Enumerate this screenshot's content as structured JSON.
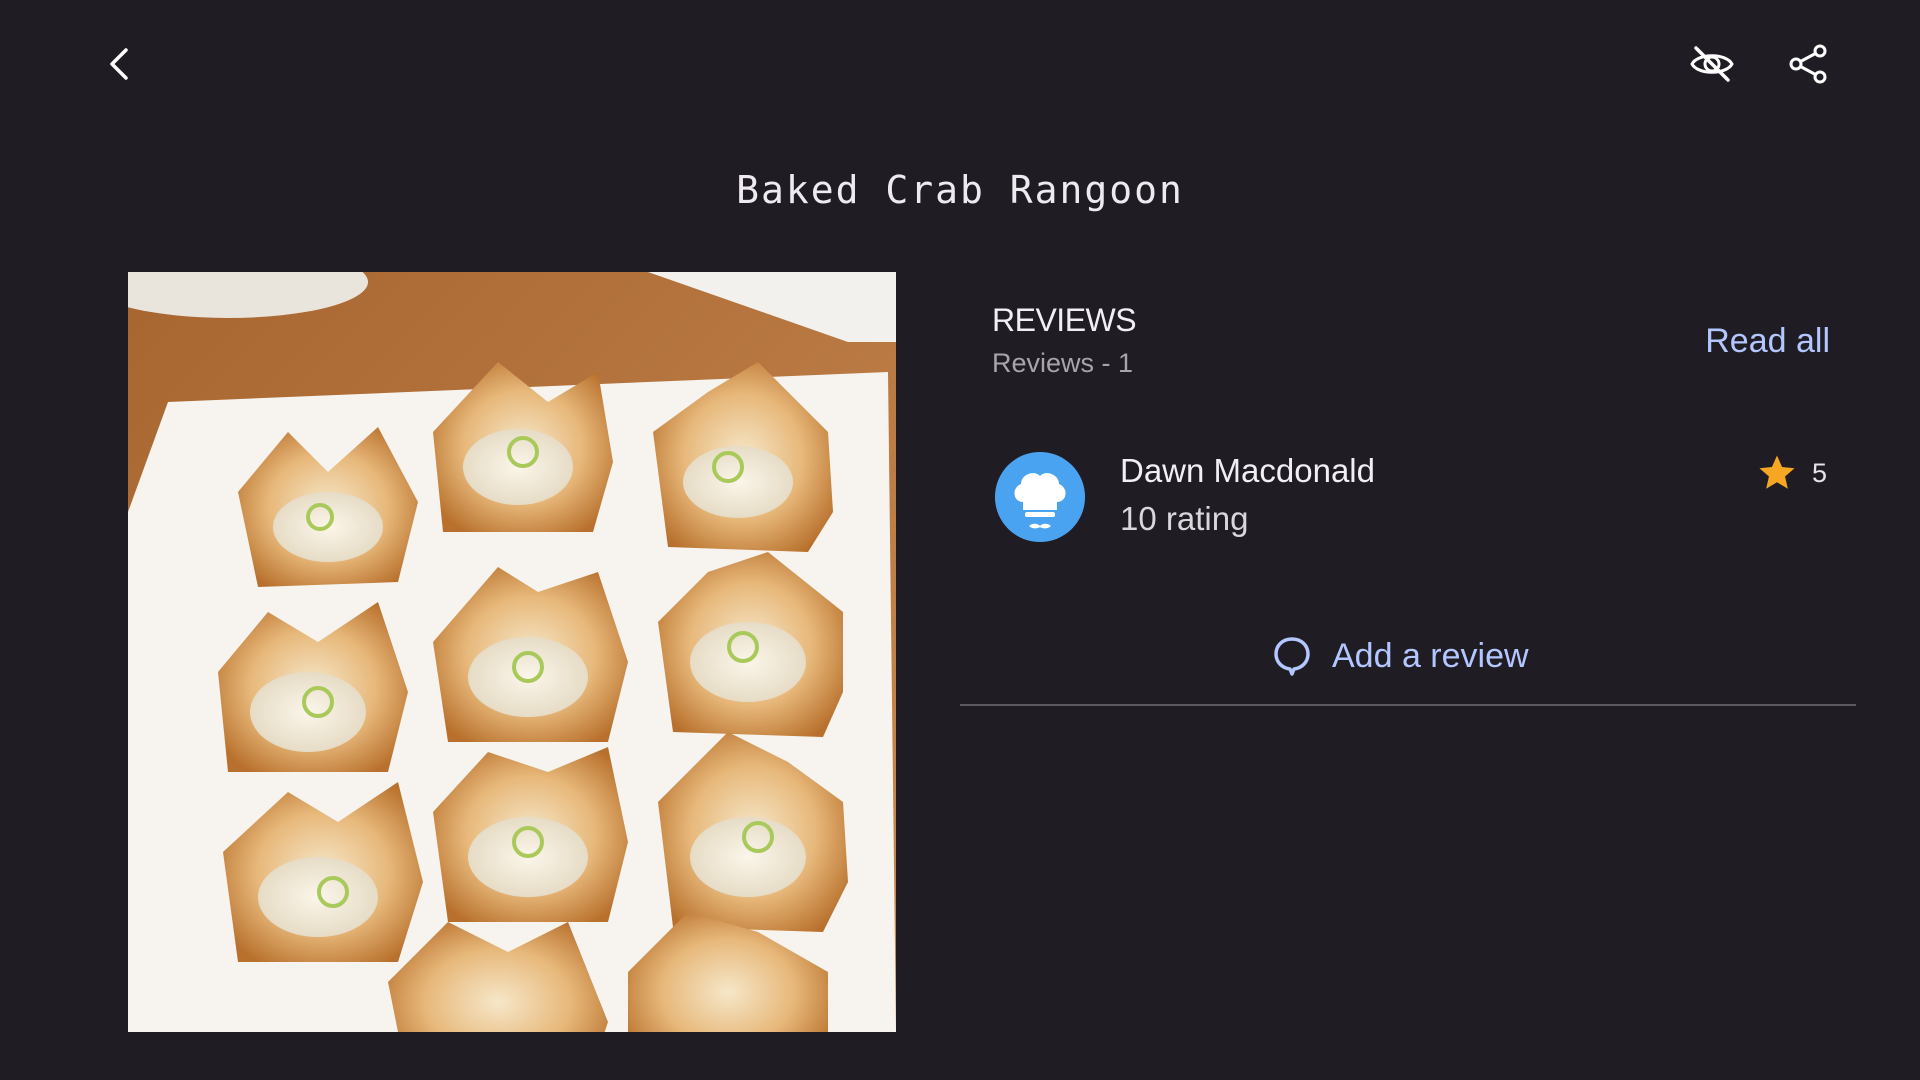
{
  "header": {
    "back_icon": "chevron-left-icon",
    "visibility_icon": "eye-off-icon",
    "share_icon": "share-icon"
  },
  "recipe": {
    "title": "Baked Crab Rangoon",
    "image_alt": "Baked crab rangoon wonton cups on a white plate"
  },
  "reviews": {
    "heading": "REVIEWS",
    "count_text": "Reviews - 1",
    "read_all_label": "Read all",
    "items": [
      {
        "name": "Dawn Macdonald",
        "rating_text": "10 rating",
        "stars": "5",
        "avatar_icon": "chef-hat-icon"
      }
    ],
    "add_review_label": "Add a review",
    "add_review_icon": "comment-bubble-icon"
  },
  "colors": {
    "background": "#1f1d23",
    "accent": "#b3c6ff",
    "star": "#f5a623",
    "avatar": "#4aa3f0"
  }
}
